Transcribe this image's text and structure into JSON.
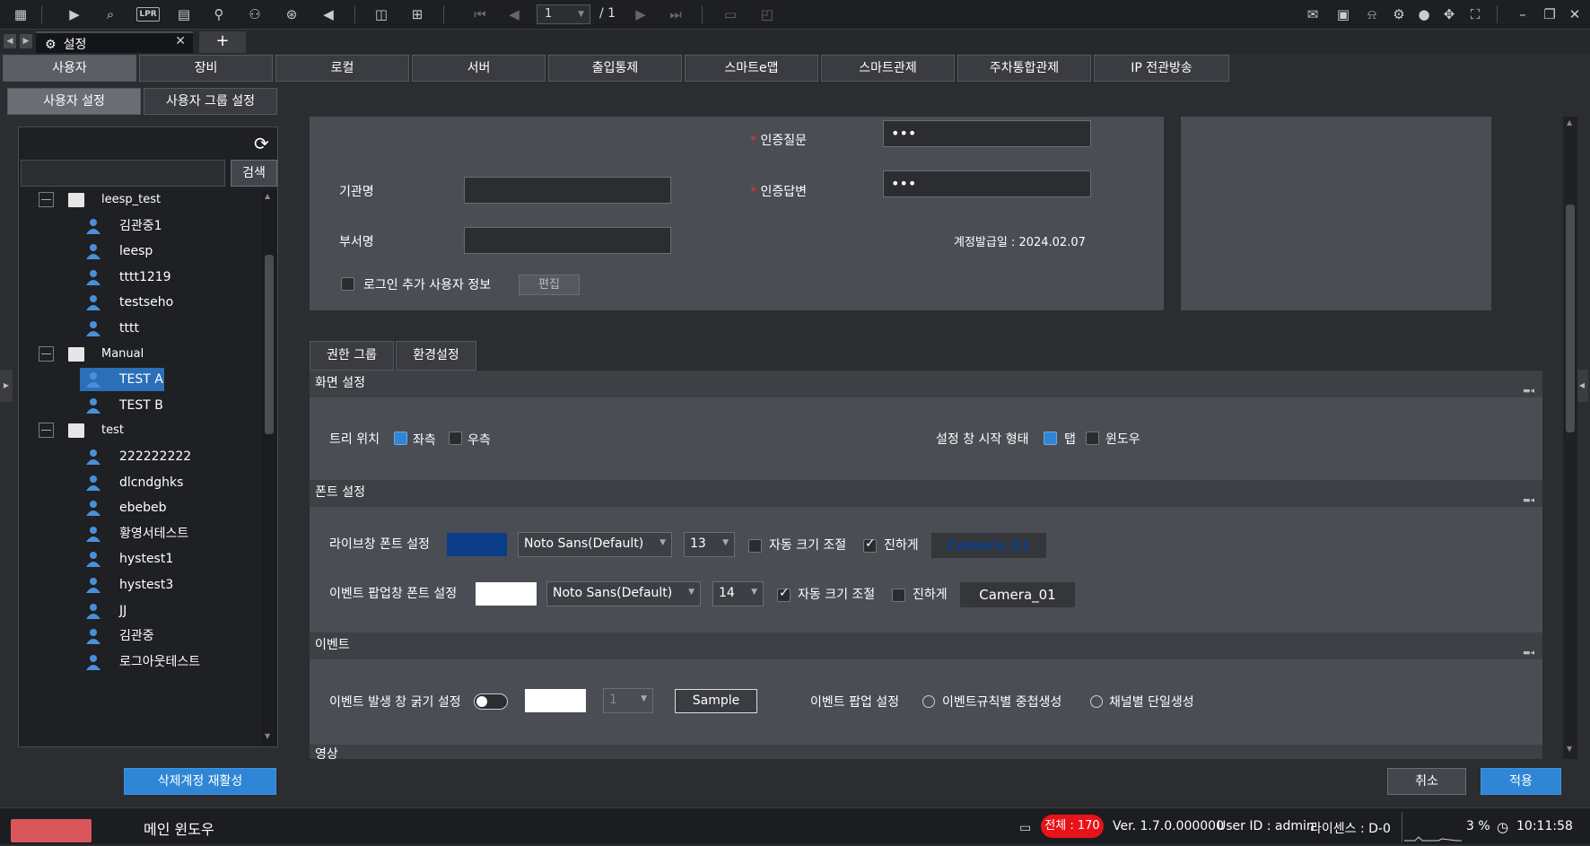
{
  "toolbar": {
    "page_current": "1",
    "page_total": "/ 1",
    "icons_left": [
      "apps-grid-icon",
      "live-play-icon",
      "playback-search-icon",
      "lpr-icon",
      "map-icon",
      "person-search-icon",
      "bicycle-icon",
      "location-search-icon",
      "broadcast-icon",
      "split-screen-icon",
      "add-camera-icon"
    ],
    "lpr_label": "LPR"
  },
  "doc_tab": {
    "label": "설정",
    "plus": "+"
  },
  "main_tabs": [
    "사용자",
    "장비",
    "로컬",
    "서버",
    "출입통제",
    "스마트e맵",
    "스마트관제",
    "주차통합관제",
    "IP 전관방송"
  ],
  "sub_tabs": [
    "사용자 설정",
    "사용자 그룹 설정"
  ],
  "left": {
    "search_button": "검색",
    "search_placeholder": "",
    "tree": [
      {
        "type": "group",
        "label": "leesp_test"
      },
      {
        "type": "user",
        "label": "김관중1"
      },
      {
        "type": "user",
        "label": "leesp"
      },
      {
        "type": "user",
        "label": "tttt1219"
      },
      {
        "type": "user",
        "label": "testseho"
      },
      {
        "type": "user",
        "label": "tttt"
      },
      {
        "type": "group",
        "label": "Manual"
      },
      {
        "type": "user",
        "label": "TEST A",
        "selected": true
      },
      {
        "type": "user",
        "label": "TEST B"
      },
      {
        "type": "group",
        "label": "test"
      },
      {
        "type": "user",
        "label": "222222222"
      },
      {
        "type": "user",
        "label": "dlcndghks"
      },
      {
        "type": "user",
        "label": "ebebeb"
      },
      {
        "type": "user",
        "label": "황영서테스트"
      },
      {
        "type": "user",
        "label": "hystest1"
      },
      {
        "type": "user",
        "label": "hystest3"
      },
      {
        "type": "user",
        "label": "JJ"
      },
      {
        "type": "user",
        "label": "김관중"
      },
      {
        "type": "user",
        "label": "로그아웃테스트"
      }
    ],
    "restore_button": "삭제계정 재활성"
  },
  "form": {
    "auth_question_label": "인증질문",
    "auth_question_value": "•••",
    "auth_answer_label": "인증답변",
    "auth_answer_value": "•••",
    "org_label": "기관명",
    "dept_label": "부서명",
    "issue_date": "계정발급일 : 2024.02.07",
    "login_extra_label": "로그인 추가 사용자 정보",
    "edit_button": "편집",
    "required_mark": "*"
  },
  "settings_tabs": [
    "권한 그룹",
    "환경설정"
  ],
  "screen": {
    "title": "화면 설정",
    "tree_pos_label": "트리 위치",
    "left_label": "좌측",
    "right_label": "우측",
    "start_mode_label": "설정 창 시작 형태",
    "tab_label": "탭",
    "window_label": "윈도우"
  },
  "font": {
    "title": "폰트 설정",
    "live_label": "라이브창 폰트 설정",
    "live_color": "#0a3d8a",
    "live_font": "Noto Sans(Default)",
    "live_size": "13",
    "auto_size_label": "자동 크기 조절",
    "bold_label": "진하게",
    "live_sample": "Camera_01",
    "event_label": "이벤트 팝업창 폰트 설정",
    "event_color": "#ffffff",
    "event_font": "Noto Sans(Default)",
    "event_size": "14",
    "event_sample": "Camera_01"
  },
  "event": {
    "title": "이벤트",
    "thickness_label": "이벤트 발생 창 굵기 설정",
    "thickness_value": "1",
    "sample_button": "Sample",
    "popup_label": "이벤트 팝업 설정",
    "opt1": "이벤트규칙별 중첩생성",
    "opt2": "채널별 단일생성"
  },
  "video": {
    "title": "영상"
  },
  "actions": {
    "cancel": "취소",
    "apply": "적용"
  },
  "status": {
    "window_name": "메인 윈도우",
    "total": "전체 : 170",
    "version": "Ver. 1.7.0.000000",
    "user_id": "User ID : admin",
    "license": "라이센스 : D-0",
    "cpu": "3 %",
    "time": "10:11:58"
  },
  "colors": {
    "accent": "#2f86d6",
    "alert": "#e8121a",
    "required": "#e03a3a"
  }
}
